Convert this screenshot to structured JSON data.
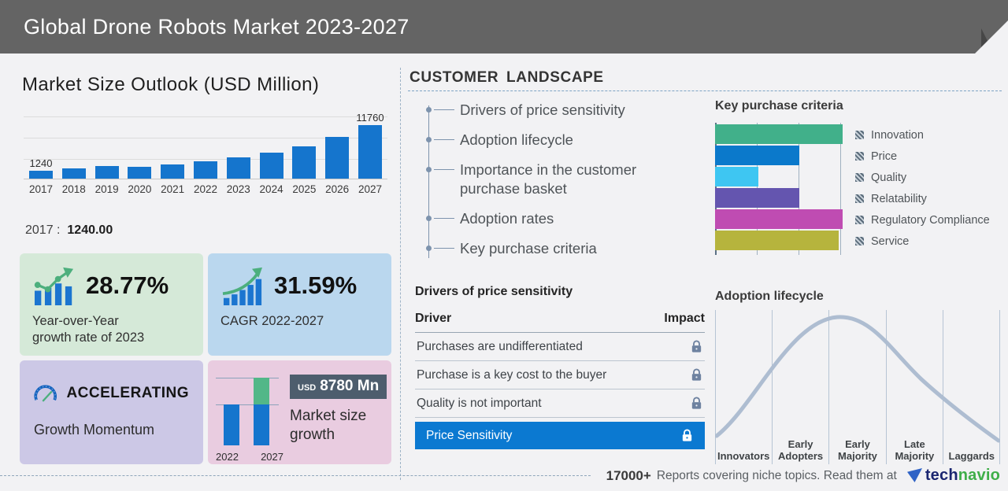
{
  "header": {
    "title": "Global Drone Robots Market 2023-2027",
    "bg_color": "#646464"
  },
  "market_size": {
    "title": "Market Size Outlook (USD Million)",
    "tooltip_year": "2017",
    "tooltip_sep": ":",
    "tooltip_value": "1240.00"
  },
  "stats": {
    "yoy": {
      "value": "28.77%",
      "caption_line1": "Year-over-Year",
      "caption_line2": "growth rate of 2023",
      "bg_color": "#d5e9d8"
    },
    "cagr": {
      "value": "31.59%",
      "caption": "CAGR 2022-2027",
      "bg_color": "#bad7ee"
    },
    "momentum": {
      "status": "ACCELERATING",
      "caption": "Growth Momentum",
      "bg_color": "#ccc8e6"
    },
    "growth": {
      "currency": "USD",
      "amount": "8780 Mn",
      "caption": "Market size growth",
      "badge_bg": "#4d5d6d",
      "bg_color": "#e9cce0"
    }
  },
  "customer_landscape": {
    "title": "CUSTOMER LANDSCAPE",
    "items": [
      "Drivers of price sensitivity",
      "Adoption lifecycle",
      "Importance in the customer purchase basket",
      "Adoption rates",
      "Key purchase criteria"
    ]
  },
  "price_table": {
    "title": "Drivers of price sensitivity",
    "col_driver": "Driver",
    "col_impact": "Impact",
    "rows": [
      "Purchases are undifferentiated",
      "Purchase is a key cost to the buyer",
      "Quality is not important"
    ],
    "highlight": "Price Sensitivity",
    "highlight_bg": "#0b79d1",
    "lock_color": "#6e82a0"
  },
  "footer": {
    "count": "17000+",
    "text": "Reports covering niche topics. Read them at",
    "brand_prefix": "tech",
    "brand_suffix": "navio",
    "brand_prefix_color": "#1a2570",
    "brand_suffix_color": "#3fae49"
  },
  "chart_data": [
    {
      "type": "bar",
      "title": "Market Size Outlook (USD Million)",
      "categories": [
        "2017",
        "2018",
        "2019",
        "2020",
        "2021",
        "2022",
        "2023",
        "2024",
        "2025",
        "2026",
        "2027"
      ],
      "values": [
        1240,
        1500,
        1800,
        1750,
        2100,
        2980,
        3840,
        4800,
        6100,
        8100,
        11760
      ],
      "first_label": "1240",
      "last_label": "11760",
      "ylabel": "USD Million",
      "bar_color": "#1575cd",
      "grid": true,
      "note": "only 2017 (1240) and 2027 (11760) carry data labels; other values estimated from bar heights"
    },
    {
      "type": "bar",
      "orientation": "horizontal",
      "title": "Key purchase criteria",
      "categories": [
        "Innovation",
        "Price",
        "Quality",
        "Relatability",
        "Regulatory Compliance",
        "Service"
      ],
      "values_pct": [
        100,
        66,
        34,
        66,
        100,
        97
      ],
      "colors": [
        "#41b08a",
        "#0b79cb",
        "#3ec6f2",
        "#6455af",
        "#bf4cb2",
        "#b6b43d"
      ],
      "legend_position": "right",
      "note": "relative bar lengths; axis unlabeled"
    },
    {
      "type": "bar",
      "title": "Market size growth",
      "categories": [
        "2022",
        "2027"
      ],
      "badge_label": "USD 8780 Mn",
      "growth_usd_million": 8780,
      "bar_color": "#1575cd",
      "growth_segment_color": "#52b788"
    },
    {
      "type": "line",
      "shape": "bell-curve",
      "title": "Adoption lifecycle",
      "categories": [
        "Innovators",
        "Early Adopters",
        "Early Majority",
        "Late Majority",
        "Laggards"
      ],
      "line_color": "#aebdd1"
    }
  ]
}
